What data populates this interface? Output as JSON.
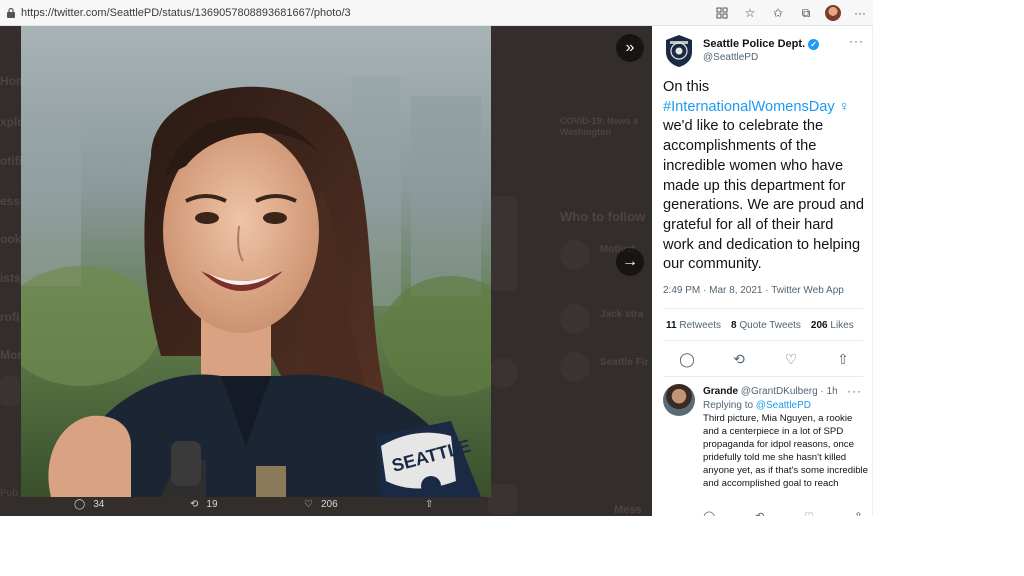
{
  "browser": {
    "url": "https://twitter.com/SeattlePD/status/1369057808893681667/photo/3"
  },
  "background": {
    "sidebar_partial": [
      "Hom",
      "xplo",
      "otifi",
      "ess",
      "ook",
      "ists",
      "rofi",
      "Mor",
      "Pub"
    ],
    "trend_label": "COVID-19: News a",
    "trend_sub": "Washington",
    "who_to_follow": "Who to follow",
    "suggestions": [
      "Motivat",
      "Jack stra",
      "Seattle Fir"
    ],
    "messages": "Mess"
  },
  "photo_actions": {
    "replies": "34",
    "retweets": "19",
    "likes": "206"
  },
  "tweet": {
    "name": "Seattle Police Dept.",
    "handle": "@SeattlePD",
    "text_pre": "On this ",
    "hashtag": "#InternationalWomensDay",
    "text_post": " we'd like to celebrate the accomplishments of the incredible women who have made up this department for generations. We are proud and grateful for all of their hard work and dedication to helping our community.",
    "timestamp": "2:49 PM · Mar 8, 2021 · Twitter Web App",
    "retweets_count": "11",
    "retweets_label": "Retweets",
    "quotes_count": "8",
    "quotes_label": "Quote Tweets",
    "likes_count": "206",
    "likes_label": "Likes"
  },
  "reply": {
    "name": "Grande",
    "handle_time": "@GrantDKulberg · 1h",
    "replying_label": "Replying to",
    "replying_to": "@SeattlePD",
    "text": "Third picture, Mia Nguyen, a rookie and a centerpiece in a lot of SPD propaganda for idpol reasons, once pridefully told me she hasn't killed anyone yet, as if that's some incredible and accomplished goal to reach"
  },
  "colors": {
    "accent": "#1d9bf0",
    "overlay": "#2b2624"
  }
}
